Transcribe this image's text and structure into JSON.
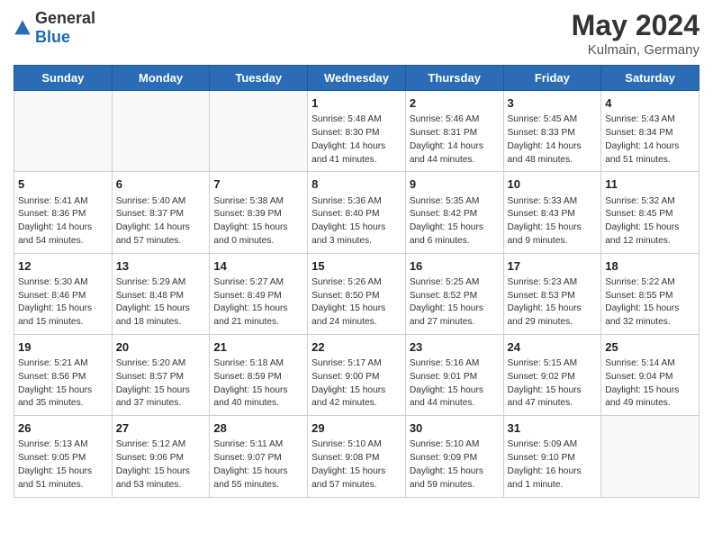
{
  "logo": {
    "text_general": "General",
    "text_blue": "Blue"
  },
  "calendar": {
    "title": "May 2024",
    "subtitle": "Kulmain, Germany",
    "days_of_week": [
      "Sunday",
      "Monday",
      "Tuesday",
      "Wednesday",
      "Thursday",
      "Friday",
      "Saturday"
    ],
    "weeks": [
      [
        {
          "day": "",
          "info": ""
        },
        {
          "day": "",
          "info": ""
        },
        {
          "day": "",
          "info": ""
        },
        {
          "day": "1",
          "info": "Sunrise: 5:48 AM\nSunset: 8:30 PM\nDaylight: 14 hours\nand 41 minutes."
        },
        {
          "day": "2",
          "info": "Sunrise: 5:46 AM\nSunset: 8:31 PM\nDaylight: 14 hours\nand 44 minutes."
        },
        {
          "day": "3",
          "info": "Sunrise: 5:45 AM\nSunset: 8:33 PM\nDaylight: 14 hours\nand 48 minutes."
        },
        {
          "day": "4",
          "info": "Sunrise: 5:43 AM\nSunset: 8:34 PM\nDaylight: 14 hours\nand 51 minutes."
        }
      ],
      [
        {
          "day": "5",
          "info": "Sunrise: 5:41 AM\nSunset: 8:36 PM\nDaylight: 14 hours\nand 54 minutes."
        },
        {
          "day": "6",
          "info": "Sunrise: 5:40 AM\nSunset: 8:37 PM\nDaylight: 14 hours\nand 57 minutes."
        },
        {
          "day": "7",
          "info": "Sunrise: 5:38 AM\nSunset: 8:39 PM\nDaylight: 15 hours\nand 0 minutes."
        },
        {
          "day": "8",
          "info": "Sunrise: 5:36 AM\nSunset: 8:40 PM\nDaylight: 15 hours\nand 3 minutes."
        },
        {
          "day": "9",
          "info": "Sunrise: 5:35 AM\nSunset: 8:42 PM\nDaylight: 15 hours\nand 6 minutes."
        },
        {
          "day": "10",
          "info": "Sunrise: 5:33 AM\nSunset: 8:43 PM\nDaylight: 15 hours\nand 9 minutes."
        },
        {
          "day": "11",
          "info": "Sunrise: 5:32 AM\nSunset: 8:45 PM\nDaylight: 15 hours\nand 12 minutes."
        }
      ],
      [
        {
          "day": "12",
          "info": "Sunrise: 5:30 AM\nSunset: 8:46 PM\nDaylight: 15 hours\nand 15 minutes."
        },
        {
          "day": "13",
          "info": "Sunrise: 5:29 AM\nSunset: 8:48 PM\nDaylight: 15 hours\nand 18 minutes."
        },
        {
          "day": "14",
          "info": "Sunrise: 5:27 AM\nSunset: 8:49 PM\nDaylight: 15 hours\nand 21 minutes."
        },
        {
          "day": "15",
          "info": "Sunrise: 5:26 AM\nSunset: 8:50 PM\nDaylight: 15 hours\nand 24 minutes."
        },
        {
          "day": "16",
          "info": "Sunrise: 5:25 AM\nSunset: 8:52 PM\nDaylight: 15 hours\nand 27 minutes."
        },
        {
          "day": "17",
          "info": "Sunrise: 5:23 AM\nSunset: 8:53 PM\nDaylight: 15 hours\nand 29 minutes."
        },
        {
          "day": "18",
          "info": "Sunrise: 5:22 AM\nSunset: 8:55 PM\nDaylight: 15 hours\nand 32 minutes."
        }
      ],
      [
        {
          "day": "19",
          "info": "Sunrise: 5:21 AM\nSunset: 8:56 PM\nDaylight: 15 hours\nand 35 minutes."
        },
        {
          "day": "20",
          "info": "Sunrise: 5:20 AM\nSunset: 8:57 PM\nDaylight: 15 hours\nand 37 minutes."
        },
        {
          "day": "21",
          "info": "Sunrise: 5:18 AM\nSunset: 8:59 PM\nDaylight: 15 hours\nand 40 minutes."
        },
        {
          "day": "22",
          "info": "Sunrise: 5:17 AM\nSunset: 9:00 PM\nDaylight: 15 hours\nand 42 minutes."
        },
        {
          "day": "23",
          "info": "Sunrise: 5:16 AM\nSunset: 9:01 PM\nDaylight: 15 hours\nand 44 minutes."
        },
        {
          "day": "24",
          "info": "Sunrise: 5:15 AM\nSunset: 9:02 PM\nDaylight: 15 hours\nand 47 minutes."
        },
        {
          "day": "25",
          "info": "Sunrise: 5:14 AM\nSunset: 9:04 PM\nDaylight: 15 hours\nand 49 minutes."
        }
      ],
      [
        {
          "day": "26",
          "info": "Sunrise: 5:13 AM\nSunset: 9:05 PM\nDaylight: 15 hours\nand 51 minutes."
        },
        {
          "day": "27",
          "info": "Sunrise: 5:12 AM\nSunset: 9:06 PM\nDaylight: 15 hours\nand 53 minutes."
        },
        {
          "day": "28",
          "info": "Sunrise: 5:11 AM\nSunset: 9:07 PM\nDaylight: 15 hours\nand 55 minutes."
        },
        {
          "day": "29",
          "info": "Sunrise: 5:10 AM\nSunset: 9:08 PM\nDaylight: 15 hours\nand 57 minutes."
        },
        {
          "day": "30",
          "info": "Sunrise: 5:10 AM\nSunset: 9:09 PM\nDaylight: 15 hours\nand 59 minutes."
        },
        {
          "day": "31",
          "info": "Sunrise: 5:09 AM\nSunset: 9:10 PM\nDaylight: 16 hours\nand 1 minute."
        },
        {
          "day": "",
          "info": ""
        }
      ]
    ]
  }
}
